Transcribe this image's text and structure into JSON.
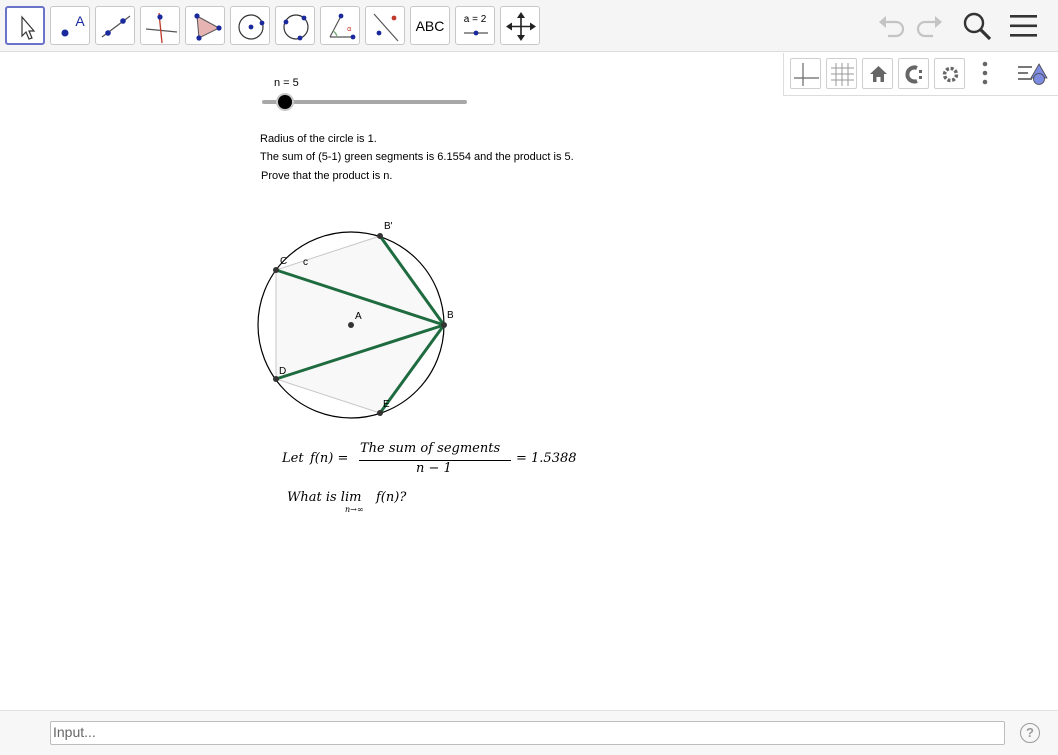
{
  "toolbar": {
    "tools": [
      {
        "icon": "move-arrow-icon"
      },
      {
        "icon": "point-icon",
        "glyph": "A"
      },
      {
        "icon": "line-icon"
      },
      {
        "icon": "perpendicular-line-icon"
      },
      {
        "icon": "polygon-icon"
      },
      {
        "icon": "circle-center-point-icon"
      },
      {
        "icon": "circle-three-points-icon"
      },
      {
        "icon": "angle-icon"
      },
      {
        "icon": "reflect-icon"
      },
      {
        "icon": "text-icon",
        "glyph": "ABC"
      },
      {
        "icon": "slider-icon",
        "glyph": "a = 2"
      },
      {
        "icon": "move-graphics-view-icon"
      }
    ],
    "right": [
      "undo-icon",
      "redo-icon",
      "search-icon",
      "menu-icon"
    ]
  },
  "stylebar": [
    "axes-icon",
    "grid-icon",
    "home-icon",
    "point-capturing-icon",
    "settings-icon",
    "more-icon",
    "view-menu-icon"
  ],
  "slider": {
    "label": "n = 5",
    "value": 5
  },
  "text": {
    "line1": "Radius of the circle is 1.",
    "line2": "The sum of (5-1) green segments is 6.1554 and the product is 5.",
    "line3": "Prove that the product is n."
  },
  "points": {
    "A": "A",
    "B": "B",
    "Bp": "B'",
    "C": "C",
    "D": "D",
    "E": "E",
    "c": "c"
  },
  "formula": {
    "let": "Let",
    "fn": "f(n) =",
    "numerator": "The sum of segments",
    "denominator": "n − 1",
    "result": "= 1.5388",
    "question": "What is lim",
    "limit_sub": "n→∞",
    "question_end": "f(n)?"
  },
  "input": {
    "placeholder": "Input..."
  },
  "help": "?",
  "colors": {
    "green": "#1e6b3f",
    "active_border": "#6a73c9",
    "toolbar_bg": "#f5f5f5"
  }
}
